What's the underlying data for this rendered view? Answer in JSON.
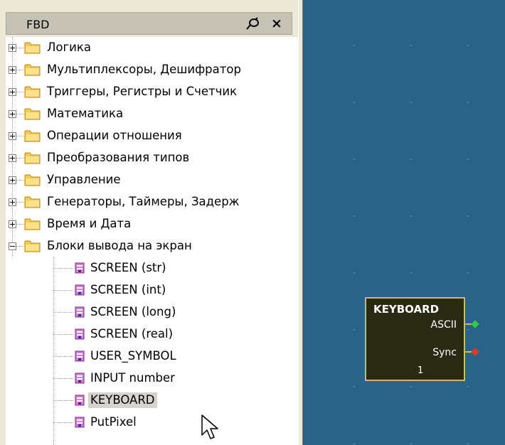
{
  "panel": {
    "title": "FBD",
    "pin_icon": "pin-icon",
    "close_icon": "close-icon"
  },
  "tree": {
    "folders": [
      {
        "label": "Логика",
        "expanded": false
      },
      {
        "label": "Мультиплексоры, Дешифратор",
        "expanded": false
      },
      {
        "label": "Триггеры, Регистры и Счетчик",
        "expanded": false
      },
      {
        "label": "Математика",
        "expanded": false
      },
      {
        "label": "Операции отношения",
        "expanded": false
      },
      {
        "label": "Преобразования типов",
        "expanded": false
      },
      {
        "label": "Управление",
        "expanded": false
      },
      {
        "label": "Генераторы, Таймеры, Задерж",
        "expanded": false
      },
      {
        "label": "Время и Дата",
        "expanded": false
      },
      {
        "label": "Блоки вывода на экран",
        "expanded": true
      }
    ],
    "leaves": [
      {
        "label": "SCREEN (str)"
      },
      {
        "label": "SCREEN (int)"
      },
      {
        "label": "SCREEN (long)"
      },
      {
        "label": "SCREEN (real)"
      },
      {
        "label": "USER_SYMBOL"
      },
      {
        "label": "INPUT number"
      },
      {
        "label": "KEYBOARD",
        "selected": true
      },
      {
        "label": "PutPixel"
      }
    ]
  },
  "canvas": {
    "block": {
      "title": "KEYBOARD",
      "outputs": [
        {
          "name": "ASCII",
          "pin_color": "#2ecc40"
        },
        {
          "name": "Sync",
          "pin_color": "#e03a1e"
        }
      ],
      "number": "1"
    }
  },
  "colors": {
    "canvas_bg": "#2a6288",
    "block_bg": "#2a2a14",
    "block_border": "#c8b870",
    "folder": "#f2cc5a"
  }
}
